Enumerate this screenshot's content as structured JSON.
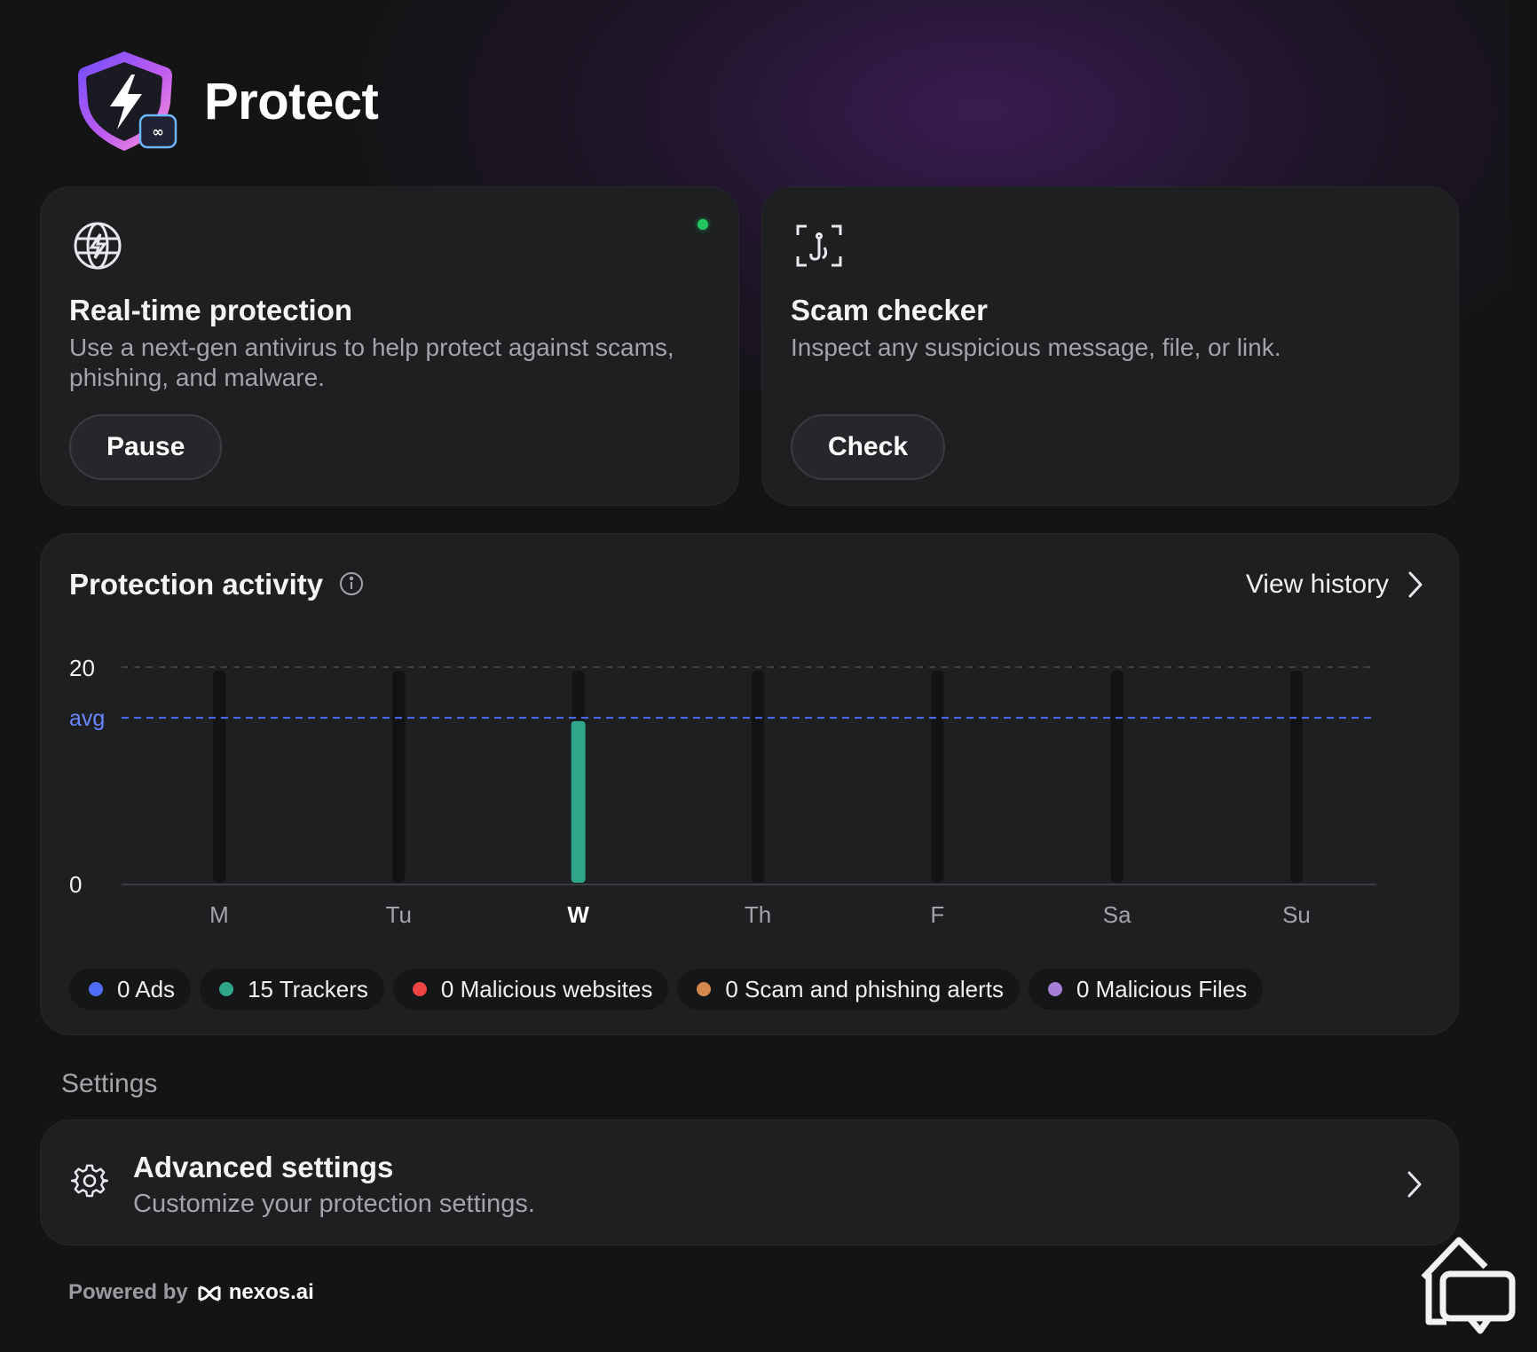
{
  "app": {
    "title": "Protect"
  },
  "realtime": {
    "title": "Real-time protection",
    "description": "Use a next-gen antivirus to help protect against scams, phishing, and malware.",
    "button": "Pause",
    "status_color": "#22c55e"
  },
  "scam": {
    "title": "Scam checker",
    "description": "Inspect any suspicious message, file, or link.",
    "button": "Check"
  },
  "activity": {
    "title": "Protection activity",
    "view_history": "View history",
    "legend": [
      {
        "label": "0 Ads",
        "color": "#4f6ef7"
      },
      {
        "label": "15 Trackers",
        "color": "#2fa58a"
      },
      {
        "label": "0 Malicious websites",
        "color": "#ef4444"
      },
      {
        "label": "0 Scam and phishing alerts",
        "color": "#d4884e"
      },
      {
        "label": "0 Malicious Files",
        "color": "#a57fd6"
      }
    ]
  },
  "chart_data": {
    "type": "bar",
    "categories": [
      "M",
      "Tu",
      "W",
      "Th",
      "F",
      "Sa",
      "Su"
    ],
    "values": [
      0,
      0,
      15,
      0,
      0,
      0,
      0
    ],
    "highlight": "W",
    "ylim": [
      0,
      20
    ],
    "yticks": [
      "20",
      "0"
    ],
    "avg_label": "avg",
    "avg_value": 15.3,
    "bar_color": "#2fa58a",
    "avg_color": "#4f6ef7",
    "grid": true
  },
  "settings": {
    "section_label": "Settings",
    "advanced_title": "Advanced settings",
    "advanced_desc": "Customize your protection settings."
  },
  "footer": {
    "powered": "Powered by",
    "brand": "nexos.ai"
  }
}
